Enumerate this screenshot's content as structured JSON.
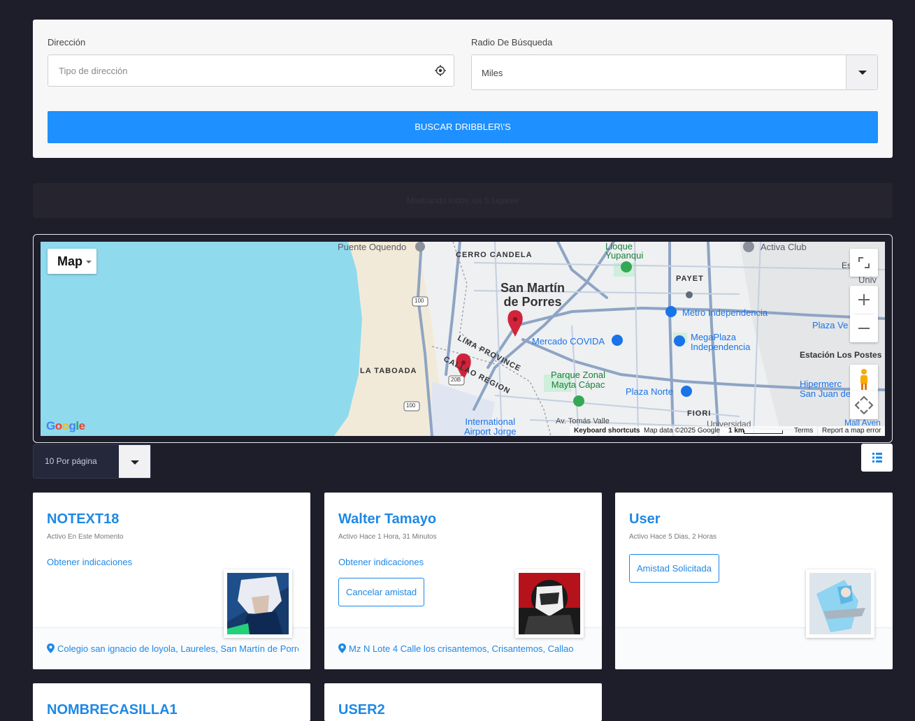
{
  "search": {
    "address_label": "Dirección",
    "address_placeholder": "Tipo de dirección",
    "radius_label": "Radio De Búsqueda",
    "radius_value": "Miles",
    "button_label": "BUSCAR DRIBBLER\\'S"
  },
  "info": {
    "text": "Mostrando todos los 5 lugares"
  },
  "map": {
    "type_label": "Map",
    "labels": {
      "puente_oquendo": "Puente Oquendo",
      "cerro_candela": "CERRO CANDELA",
      "loque_yupanqui": "Lloque\nYupanqui",
      "activa_club": "Activa Club",
      "es_s": "Es  S",
      "univ": "Univ",
      "payet": "PAYET",
      "san_martin": "San Martín\nde Porres",
      "metro_independencia": "Metro Independencia",
      "plaza_ve": "Plaza Ve",
      "lima_province": "LIMA PROVINCE",
      "mercado_covida": "Mercado COVIDA",
      "megaplaza": "MegaPlaza\nIndependencia",
      "estacion_los_postes": "Estación Los Postes",
      "la_taboada": "LA TABOADA",
      "callao_region": "CALLAO REGION",
      "parque_zonal": "Parque Zonal\nMayta Cápac",
      "plaza_norte": "Plaza Norte",
      "hipermerc": "Hipermerc\nSan Juan de",
      "fiori": "FIORI",
      "international_airport": "International\nAirport Jorge",
      "av_tomas_valle": "Av. Tomás Valle",
      "universidad": "Universidad",
      "mall_aven": "Mall Aven",
      "road_100a": "100",
      "road_100b": "100",
      "road_20b": "20B"
    },
    "footer": {
      "keyboard": "Keyboard shortcuts",
      "data": "Map data ©2025 Google",
      "scale": "1 km",
      "terms": "Terms",
      "report": "Report a map error"
    },
    "google_logo": "Google"
  },
  "pagination": {
    "per_page": "10 Por página"
  },
  "cards": [
    {
      "name": "NOTEXT18",
      "status": "Activo En Este Momento",
      "link": "Obtener indicaciones",
      "address": "Colegio san ignacio de loyola, Laureles, San Martín de Porres"
    },
    {
      "name": "Walter Tamayo",
      "status": "Activo Hace 1 Hora, 31 Minutos",
      "link": "Obtener indicaciones",
      "button": "Cancelar amistad",
      "address": "Mz N Lote 4 Calle los crisantemos, Crisantemos, Callao"
    },
    {
      "name": "User",
      "status": "Activo Hace 5 Dias, 2 Horas",
      "button": "Amistad Solicitada"
    },
    {
      "name": "NOMBRECASILLA1"
    },
    {
      "name": "USER2"
    }
  ],
  "colors": {
    "primary": "#1e90ff",
    "background": "#1e1d2a",
    "link": "#1e88e5",
    "marker": "#d0243c",
    "water": "#90daee"
  }
}
